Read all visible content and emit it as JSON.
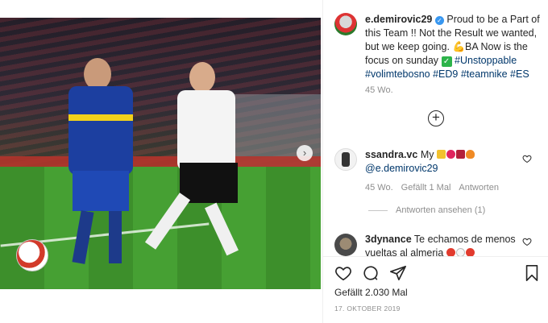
{
  "post": {
    "username": "e.demirovic29",
    "caption_text": "Proud to be a Part of this Team !! Not the Result we wanted, but we keep going.",
    "caption_flex": "💪",
    "caption_ba": "BA Now is the focus on sunday",
    "caption_check": "✓",
    "hashtags": [
      "#Unstoppable",
      "#volimtebosno",
      "#ED9",
      "#teamnike",
      "#ES"
    ],
    "caption_time": "45 Wo."
  },
  "comments": [
    {
      "username": "ssandra.vc",
      "text_prefix": "My",
      "mention": "@e.demirovic29",
      "time": "45 Wo.",
      "likes": "Gefällt 1 Mal",
      "reply_label": "Antworten",
      "view_replies": "Antworten ansehen (1)"
    },
    {
      "username": "3dynance",
      "text": "Te echamos de menos vueltas al almeria"
    }
  ],
  "footer": {
    "likes": "Gefällt 2.030 Mal",
    "date": "17. OKTOBER 2019"
  },
  "icons": {
    "verified": "✓",
    "load_more": "+",
    "next": "›"
  }
}
